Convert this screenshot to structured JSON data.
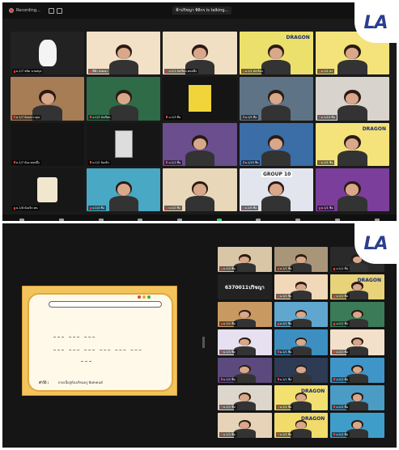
{
  "top": {
    "recording_label": "Recording...",
    "talking_label": "ฟ้าปรัชญา พิลิกร is talking...",
    "logo_text": "LA",
    "toolbar_icons": [
      "mic-icon",
      "unmute-caret",
      "share-icon",
      "participants-icon",
      "chat-icon",
      "share-screen-icon",
      "record-icon",
      "reactions-icon",
      "apps-icon",
      "more-icon"
    ],
    "banner_dragon": "DRAGON",
    "banner_group": "GROUP 10",
    "tiles": [
      {
        "name": "ม.1/7 ชนิด นามสกุล",
        "bg": "#222222",
        "kind": "dog"
      },
      {
        "name": "พี่ฟ้า อังคณา",
        "bg": "#f3e1c7",
        "kind": "person"
      },
      {
        "name": "ม.1/1 นักเรียน คนหนึ่ง",
        "bg": "#f1dfc3",
        "kind": "banner"
      },
      {
        "name": "ม.1/1 นักเรียน",
        "bg": "#ece06c",
        "kind": "dragon"
      },
      {
        "name": "ม.1/1 ดร",
        "bg": "#f4e27b",
        "kind": "dragon"
      },
      {
        "name": "ม.1/7 น้องสาว คุณ",
        "bg": "#a77d56",
        "kind": "person"
      },
      {
        "name": "ม.1/3 นักเรียน",
        "bg": "#2e6b46",
        "kind": "person"
      },
      {
        "name": "ม.1/3 ชื่อ",
        "bg": "#151515",
        "kind": "yellowcard"
      },
      {
        "name": "ม.1/5 ชื่อ",
        "bg": "#5e7486",
        "kind": "person"
      },
      {
        "name": "ม.1/10 ชื่อ",
        "bg": "#d8d3cc",
        "kind": "person"
      },
      {
        "name": "ม.1/7 น้อง คนหนึ่ง",
        "bg": "#141414",
        "kind": "empty"
      },
      {
        "name": "ม.1/2 น้องนิว",
        "bg": "#161616",
        "kind": "sketch"
      },
      {
        "name": "ม.1/1 ชื่อ",
        "bg": "#6a4e8e",
        "kind": "person"
      },
      {
        "name": "ม.1/10 ชื่อ",
        "bg": "#3b6da6",
        "kind": "person"
      },
      {
        "name": "ม.1/1 ชื่อ",
        "bg": "#f4e27b",
        "kind": "dragon"
      },
      {
        "name": "ม.1/8 น้องนิว คน",
        "bg": "#171717",
        "kind": "snoopy"
      },
      {
        "name": "ม.1/4 ชื่อ",
        "bg": "#49a8c4",
        "kind": "person"
      },
      {
        "name": "ม.1/2 ชื่อ",
        "bg": "#e8d7b9",
        "kind": "person"
      },
      {
        "name": "ม.1/5 ชื่อ",
        "bg": "#e3e5ee",
        "kind": "group"
      },
      {
        "name": "ม.1/1 ชื่อ",
        "bg": "#7b3e9a",
        "kind": "person"
      }
    ]
  },
  "bottom": {
    "logo_text": "LA",
    "sharing": {
      "blank_rows": [
        "___   ___                ___",
        "___  ___  ___  ___  ___  ___",
        "___"
      ],
      "hint_label": "คำใบ้ :",
      "hint_text": "ลวดเนื้อสู่ห้องเรียนครู พิเศษคนค์",
      "dot_colors": [
        "#e04040",
        "#e0b020",
        "#3ab04a"
      ]
    },
    "name_card": "6370011ปวิชญา",
    "tiles": [
      {
        "name": "ม.1/1 ชื่อ",
        "bg": "#d9c6a6",
        "kind": "person"
      },
      {
        "name": "ม.1/1 ชื่อ",
        "bg": "#a99577",
        "kind": "person"
      },
      {
        "name": "ม.1/1 ชื่อ",
        "bg": "#2a2a2a",
        "kind": "person"
      },
      {
        "name": "",
        "bg": "#222222",
        "kind": "namecard"
      },
      {
        "name": "ม.1/1 ชื่อ",
        "bg": "#f0d8b8",
        "kind": "person"
      },
      {
        "name": "ม.1/1 ชื่อ",
        "bg": "#e8d27a",
        "kind": "dragon"
      },
      {
        "name": "ม.1/1 ชื่อ",
        "bg": "#c89a62",
        "kind": "person"
      },
      {
        "name": "ม.1/1 ชื่อ",
        "bg": "#5fa7cf",
        "kind": "person"
      },
      {
        "name": "ม.1/1 ชื่อ",
        "bg": "#3c7b58",
        "kind": "person"
      },
      {
        "name": "ม.1/1 ชื่อ",
        "bg": "#e6e0f0",
        "kind": "person"
      },
      {
        "name": "ม.1/1 ชื่อ",
        "bg": "#3c8fc0",
        "kind": "person"
      },
      {
        "name": "ม.1/1 ชื่อ",
        "bg": "#f3e0cb",
        "kind": "person"
      },
      {
        "name": "ม.1/1 ชื่อ",
        "bg": "#5c4a7e",
        "kind": "person"
      },
      {
        "name": "ม.1/1 ชื่อ",
        "bg": "#2e3b55",
        "kind": "person"
      },
      {
        "name": "ม.1/1 ชื่อ",
        "bg": "#3f95c8",
        "kind": "person"
      },
      {
        "name": "ม.1/1 ชื่อ",
        "bg": "#dcd6cc",
        "kind": "person"
      },
      {
        "name": "ม.1/1 ชื่อ",
        "bg": "#f2e070",
        "kind": "dragon"
      },
      {
        "name": "ม.1/1 ชื่อ",
        "bg": "#4a9cc4",
        "kind": "person"
      },
      {
        "name": "ม.1/1 ชื่อ",
        "bg": "#e6d3b8",
        "kind": "person"
      },
      {
        "name": "ม.1/1 ชื่อ",
        "bg": "#f1dc6b",
        "kind": "dragon"
      },
      {
        "name": "ม.1/1 ชื่อ",
        "bg": "#3f9ec9",
        "kind": "person"
      }
    ]
  }
}
